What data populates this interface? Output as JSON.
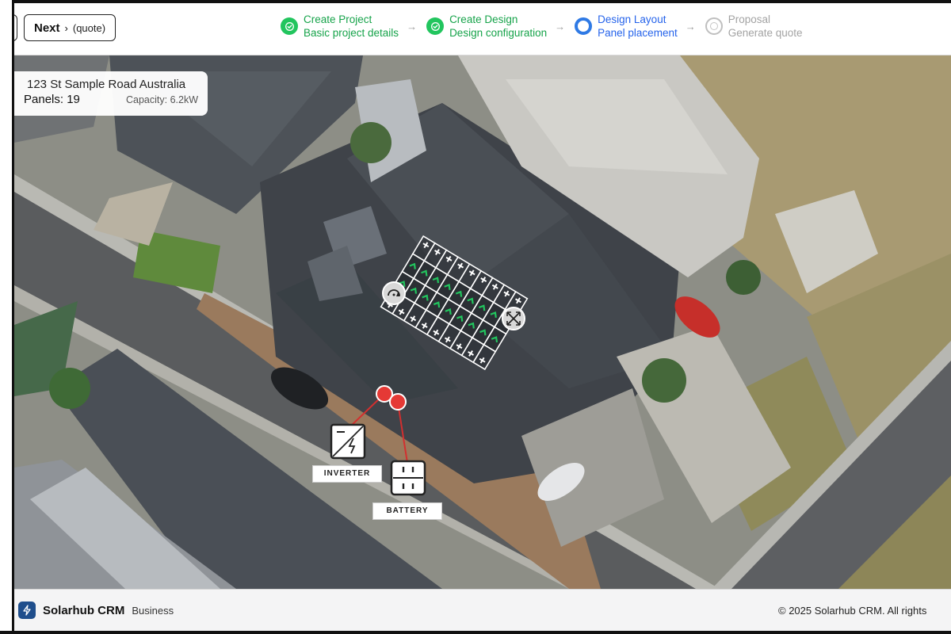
{
  "header": {
    "next_button": {
      "label": "Next",
      "chevron": "›",
      "sub": "(quote)"
    },
    "steps": [
      {
        "title": "Create Project",
        "subtitle": "Basic project details",
        "status": "done"
      },
      {
        "title": "Create Design",
        "subtitle": "Design configuration",
        "status": "done"
      },
      {
        "title": "Design Layout",
        "subtitle": "Panel placement",
        "status": "current"
      },
      {
        "title": "Proposal",
        "subtitle": "Generate quote",
        "status": "pending"
      }
    ],
    "step_arrow": "→"
  },
  "info_card": {
    "address": "123 St Sample Road Australia",
    "panels": "Panels: 19",
    "capacity": "Capacity: 6.2kW"
  },
  "equipment": {
    "inverter_label": "INVERTER",
    "battery_label": "BATTERY"
  },
  "map_controls": {
    "rotate_icon": "rotate-icon",
    "move_icon": "move-icon"
  },
  "footer": {
    "brand": "Solarhub CRM",
    "tier": "Business",
    "copyright": "© 2025 Solarhub CRM. All rights"
  },
  "colors": {
    "done": "#22c55e",
    "current": "#2f7ae5",
    "pending": "#bfbfbf",
    "marker": "#e53935",
    "logo": "#1f4e8c"
  }
}
